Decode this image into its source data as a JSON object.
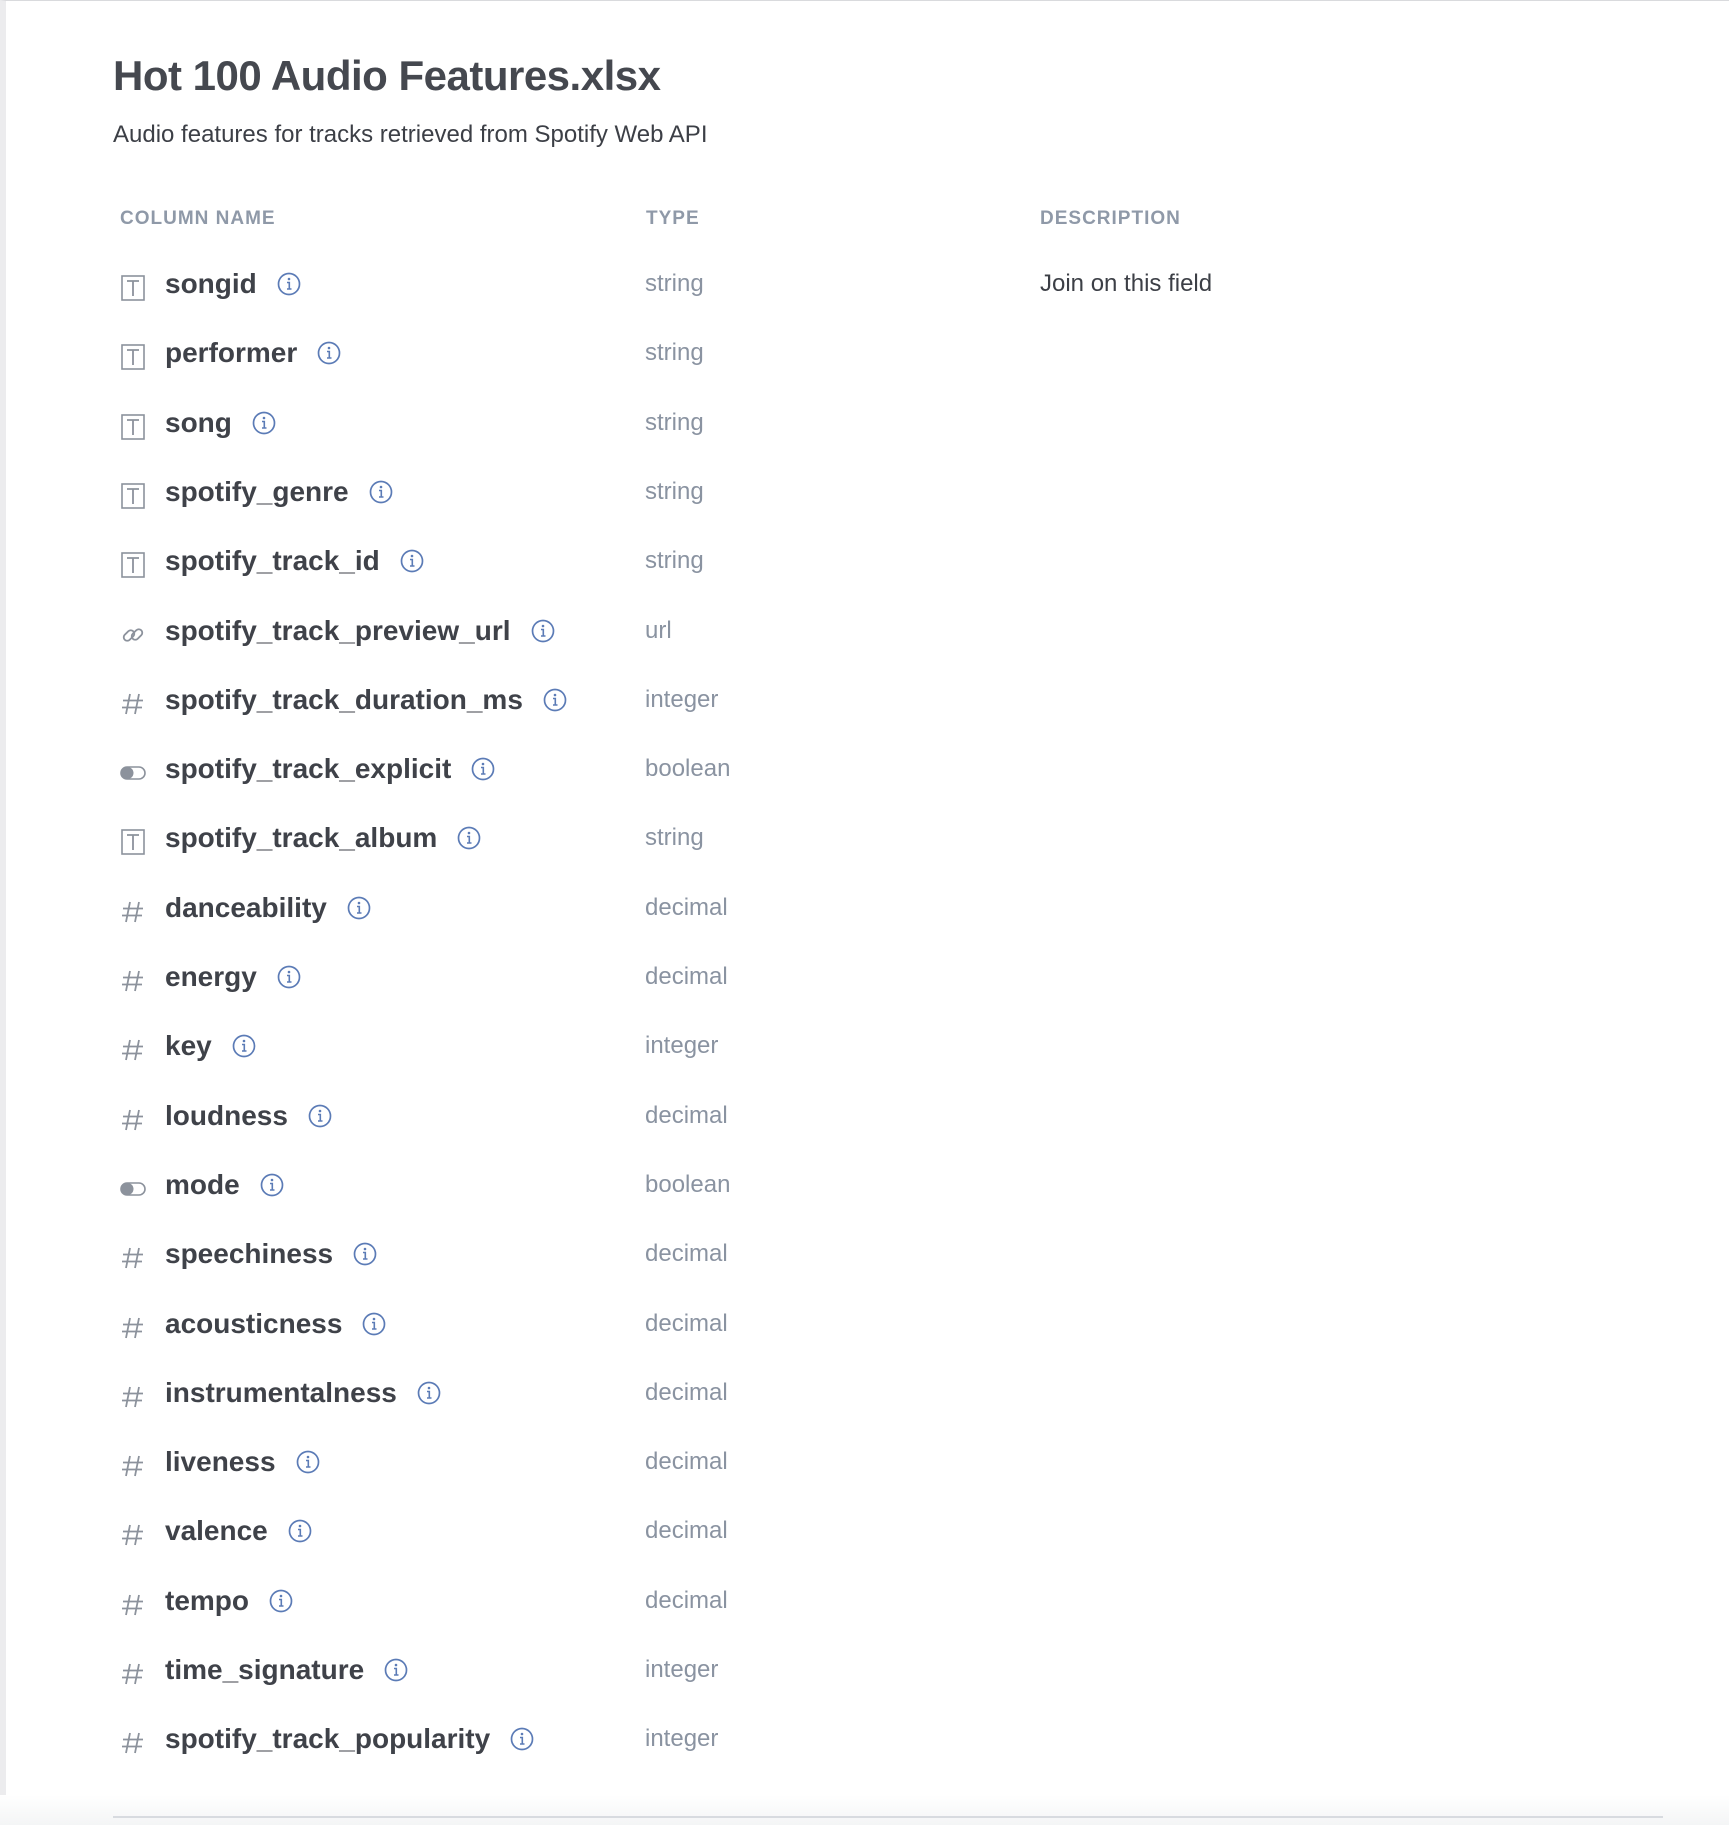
{
  "file": {
    "title": "Hot 100 Audio Features.xlsx",
    "subtitle": "Audio features for tracks retrieved from Spotify Web API"
  },
  "table": {
    "headers": {
      "name": "COLUMN NAME",
      "type": "TYPE",
      "description": "DESCRIPTION"
    },
    "rows": [
      {
        "icon": "text-type-icon",
        "name": "songid",
        "type": "string",
        "description": "Join on this field"
      },
      {
        "icon": "text-type-icon",
        "name": "performer",
        "type": "string",
        "description": ""
      },
      {
        "icon": "text-type-icon",
        "name": "song",
        "type": "string",
        "description": ""
      },
      {
        "icon": "text-type-icon",
        "name": "spotify_genre",
        "type": "string",
        "description": ""
      },
      {
        "icon": "text-type-icon",
        "name": "spotify_track_id",
        "type": "string",
        "description": ""
      },
      {
        "icon": "link-type-icon",
        "name": "spotify_track_preview_url",
        "type": "url",
        "description": ""
      },
      {
        "icon": "number-type-icon",
        "name": "spotify_track_duration_ms",
        "type": "integer",
        "description": ""
      },
      {
        "icon": "toggle-type-icon",
        "name": "spotify_track_explicit",
        "type": "boolean",
        "description": ""
      },
      {
        "icon": "text-type-icon",
        "name": "spotify_track_album",
        "type": "string",
        "description": ""
      },
      {
        "icon": "number-type-icon",
        "name": "danceability",
        "type": "decimal",
        "description": ""
      },
      {
        "icon": "number-type-icon",
        "name": "energy",
        "type": "decimal",
        "description": ""
      },
      {
        "icon": "number-type-icon",
        "name": "key",
        "type": "integer",
        "description": ""
      },
      {
        "icon": "number-type-icon",
        "name": "loudness",
        "type": "decimal",
        "description": ""
      },
      {
        "icon": "toggle-type-icon",
        "name": "mode",
        "type": "boolean",
        "description": ""
      },
      {
        "icon": "number-type-icon",
        "name": "speechiness",
        "type": "decimal",
        "description": ""
      },
      {
        "icon": "number-type-icon",
        "name": "acousticness",
        "type": "decimal",
        "description": ""
      },
      {
        "icon": "number-type-icon",
        "name": "instrumentalness",
        "type": "decimal",
        "description": ""
      },
      {
        "icon": "number-type-icon",
        "name": "liveness",
        "type": "decimal",
        "description": ""
      },
      {
        "icon": "number-type-icon",
        "name": "valence",
        "type": "decimal",
        "description": ""
      },
      {
        "icon": "number-type-icon",
        "name": "tempo",
        "type": "decimal",
        "description": ""
      },
      {
        "icon": "number-type-icon",
        "name": "time_signature",
        "type": "integer",
        "description": ""
      },
      {
        "icon": "number-type-icon",
        "name": "spotify_track_popularity",
        "type": "integer",
        "description": ""
      }
    ]
  },
  "colors": {
    "icon_gray": "#8c929c",
    "info_blue": "#5b7bb6",
    "header_gray": "#8f99a8",
    "type_gray": "#8a93a1"
  }
}
